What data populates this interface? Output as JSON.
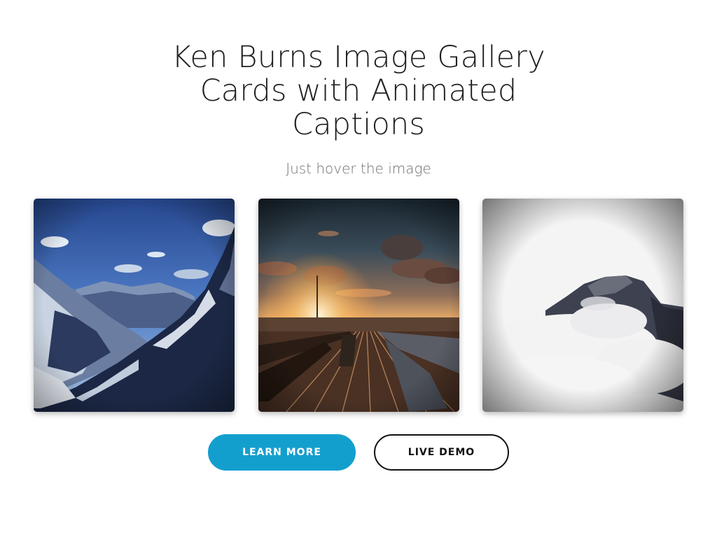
{
  "header": {
    "title": "Ken Burns Image Gallery Cards with Animated Captions",
    "subtitle": "Just hover the image"
  },
  "gallery": {
    "cards": [
      {
        "name": "mountain-valley-image"
      },
      {
        "name": "railyard-sunset-image"
      },
      {
        "name": "foggy-peak-image"
      }
    ]
  },
  "actions": {
    "learn_more": "LEARN MORE",
    "live_demo": "LIVE DEMO"
  },
  "colors": {
    "accent": "#139fce",
    "text": "#1f1f1f",
    "muted": "#707070"
  }
}
